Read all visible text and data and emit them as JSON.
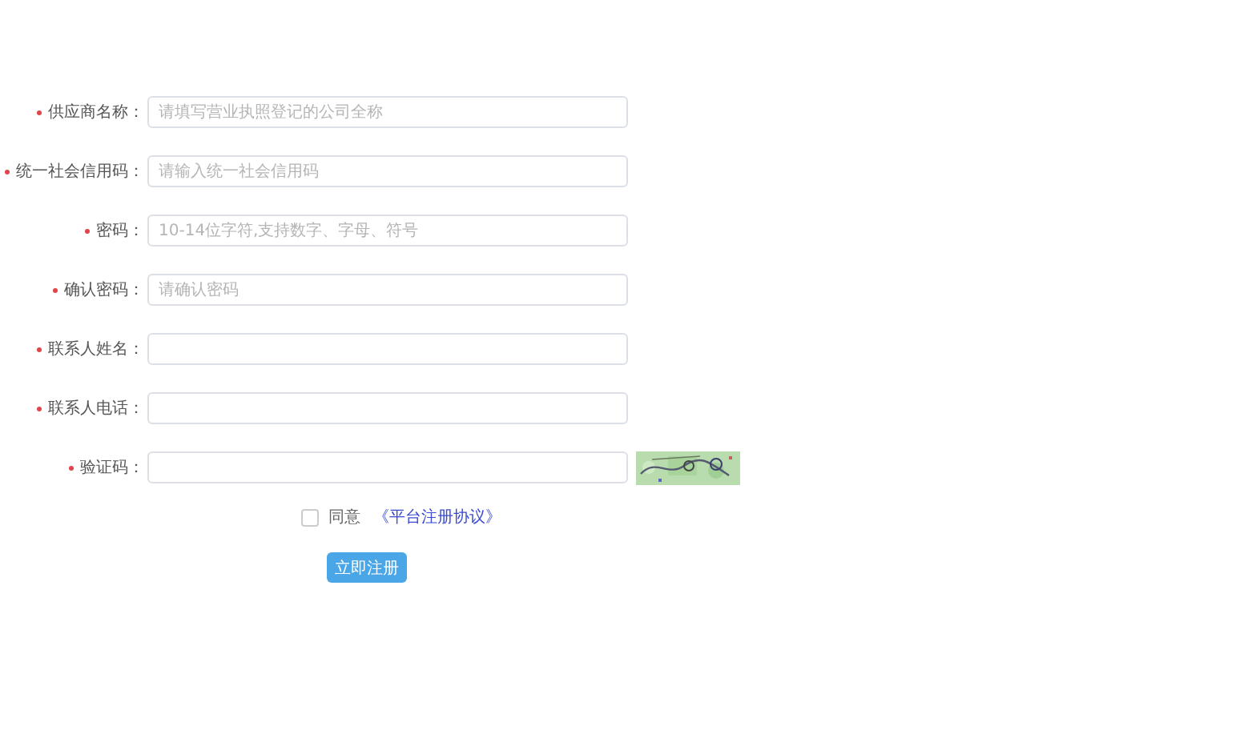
{
  "fields": [
    {
      "label": "供应商名称：",
      "required": true,
      "placeholder": "请填写营业执照登记的公司全称",
      "kind": "text"
    },
    {
      "label": "统一社会信用码：",
      "required": true,
      "placeholder": "请输入统一社会信用码",
      "kind": "text"
    },
    {
      "label": "密码：",
      "required": true,
      "placeholder": "10-14位字符,支持数字、字母、符号",
      "kind": "text"
    },
    {
      "label": "确认密码：",
      "required": true,
      "placeholder": "请确认密码",
      "kind": "text"
    },
    {
      "label": "联系人姓名：",
      "required": true,
      "kind": "text"
    },
    {
      "label": "联系人电话：",
      "required": true,
      "kind": "text"
    },
    {
      "label": "验证码：",
      "required": true,
      "kind": "captcha"
    }
  ],
  "agreement": {
    "checked": false,
    "label": "同意",
    "link": "《平台注册协议》"
  },
  "submit": "立即注册"
}
